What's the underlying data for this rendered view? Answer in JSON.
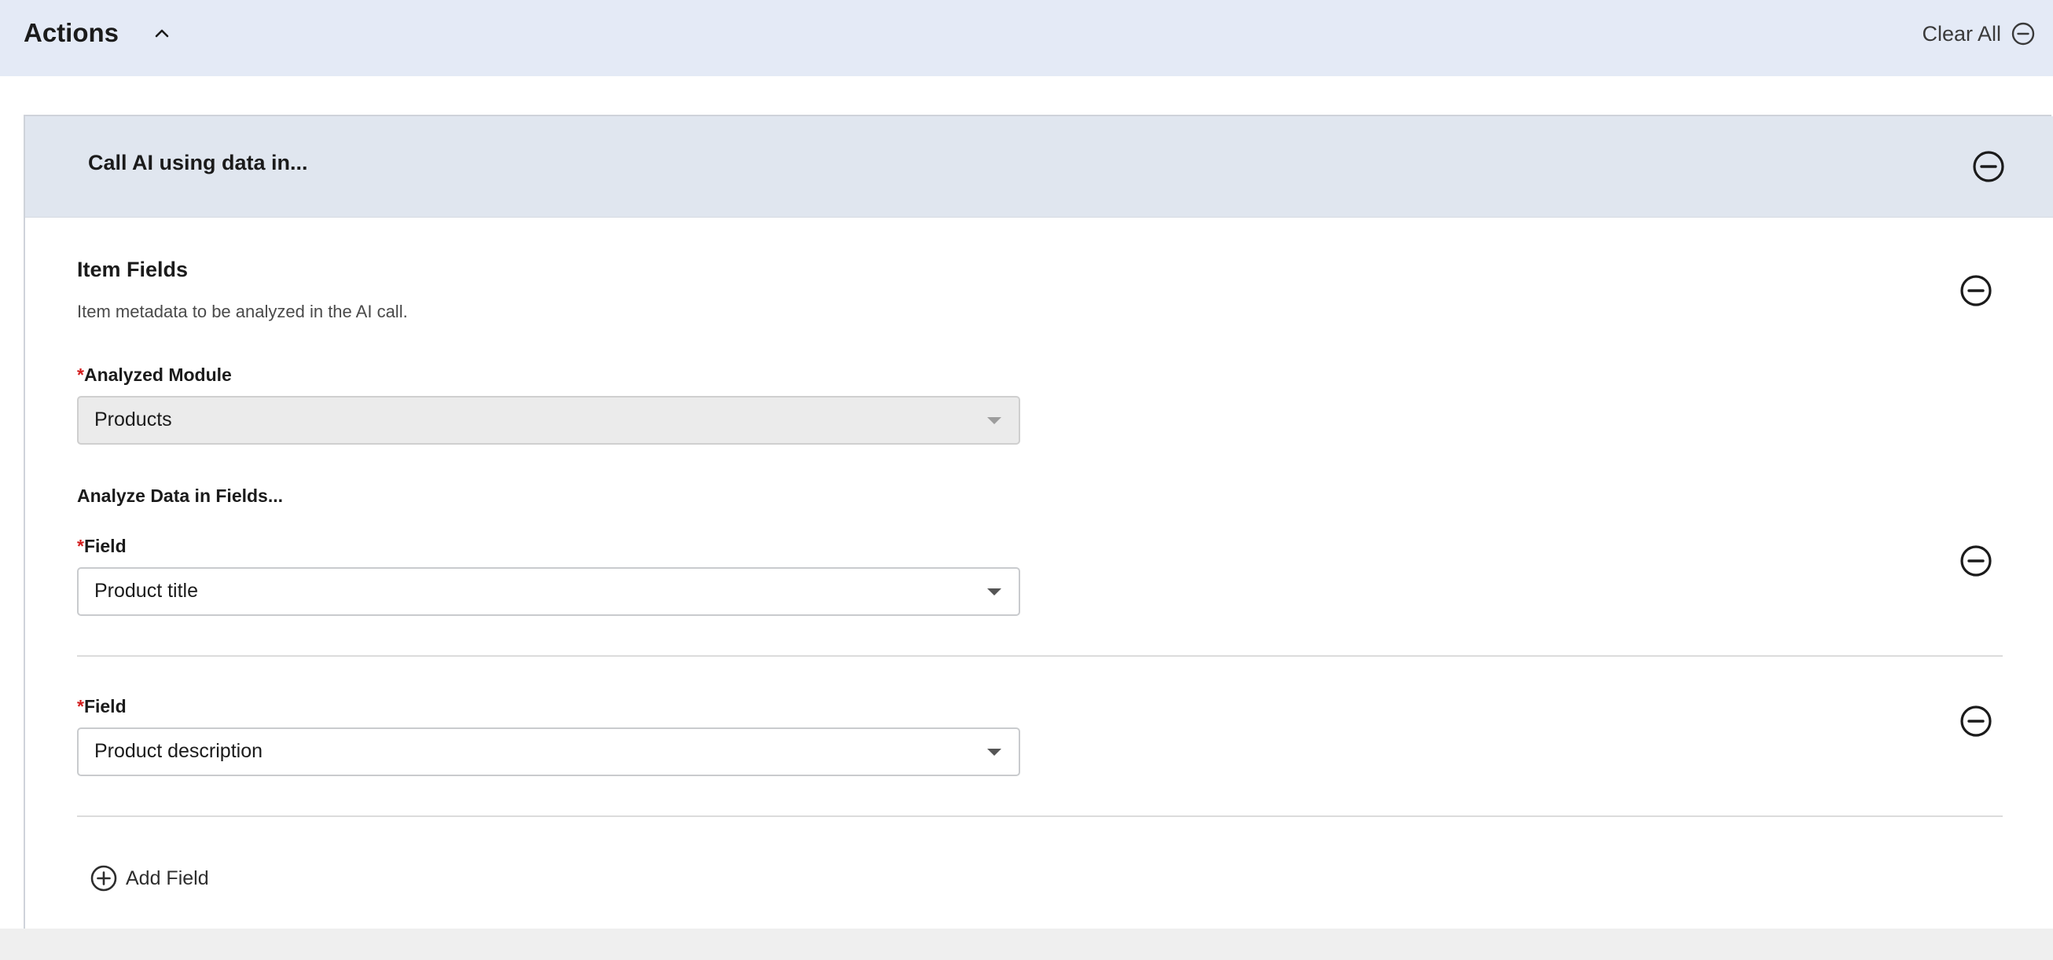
{
  "header": {
    "title": "Actions",
    "clear_all_label": "Clear All"
  },
  "panel": {
    "title": "Call AI using data in...",
    "section": {
      "title": "Item Fields",
      "description": "Item metadata to be analyzed in the AI call.",
      "analyzed_module": {
        "required_mark": "*",
        "label": "Analyzed Module",
        "value": "Products"
      },
      "subheading": "Analyze Data in Fields...",
      "fields": [
        {
          "required_mark": "*",
          "label": "Field",
          "value": "Product title"
        },
        {
          "required_mark": "*",
          "label": "Field",
          "value": "Product description"
        }
      ],
      "add_field_label": "Add Field"
    }
  },
  "colors": {
    "header_bg": "#e4eaf6",
    "panel_header_bg": "#e0e6ef",
    "required": "#d21c1c",
    "disabled_bg": "#ebebeb"
  },
  "icons": [
    "chevron-up-icon",
    "minus-circle-icon",
    "plus-circle-icon",
    "caret-down-icon"
  ]
}
